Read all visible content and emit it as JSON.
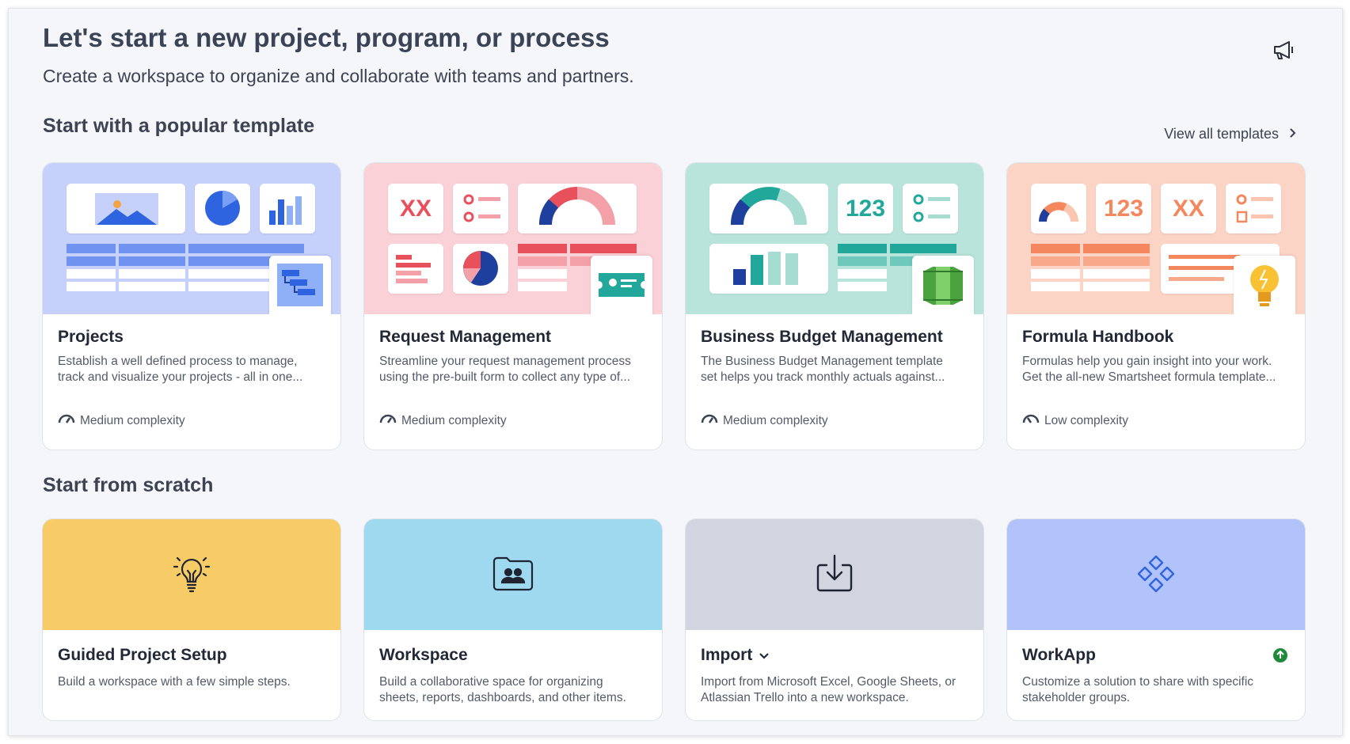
{
  "header": {
    "title": "Let's start a new project, program, or process",
    "subtitle": "Create a workspace to organize and collaborate with teams and partners.",
    "announce_icon": "megaphone-icon"
  },
  "templates_section": {
    "title": "Start with a popular template",
    "view_all": "View all templates",
    "cards": [
      {
        "title": "Projects",
        "desc1": "Establish a well defined process to manage,",
        "desc2": "track and visualize your projects - all in one...",
        "complexity": "Medium complexity",
        "bg": "#c5d1fb"
      },
      {
        "title": "Request Management",
        "desc1": "Streamline your request management process",
        "desc2": "using the pre-built form to collect any type of...",
        "complexity": "Medium complexity",
        "bg": "#f9d1d6",
        "tile_text": "XX"
      },
      {
        "title": "Business Budget Management",
        "desc1": "The Business Budget Management template",
        "desc2": "set helps you track monthly actuals against...",
        "complexity": "Medium complexity",
        "bg": "#b9e4dc",
        "tile_text": "123"
      },
      {
        "title": "Formula Handbook",
        "desc1": "Formulas help you gain insight into your work.",
        "desc2": "Get the all-new Smartsheet formula template...",
        "complexity": "Low complexity",
        "bg": "#fbd4c6",
        "tile_text_1": "123",
        "tile_text_2": "XX"
      }
    ]
  },
  "scratch_section": {
    "title": "Start from scratch",
    "cards": [
      {
        "title": "Guided Project Setup",
        "desc1": "Build a workspace with a few simple steps.",
        "desc2": "",
        "icon": "lightbulb-icon",
        "bg": "#f7cb65"
      },
      {
        "title": "Workspace",
        "desc1": "Build a collaborative space for organizing",
        "desc2": "sheets, reports, dashboards, and other items.",
        "icon": "workspace-folder-icon",
        "bg": "#9fd9f0"
      },
      {
        "title": "Import",
        "desc1": "Import from Microsoft Excel, Google Sheets, or",
        "desc2": "Atlassian Trello into a new workspace.",
        "icon": "import-icon",
        "bg": "#d2d4e0"
      },
      {
        "title": "WorkApp",
        "desc1": "Customize a solution to share with specific",
        "desc2": "stakeholder groups.",
        "icon": "workapp-icon",
        "bg": "#b2c2fb"
      }
    ]
  },
  "colors": {
    "blue": "#2f64e0",
    "navy": "#1f3f9e",
    "red": "#e8505b",
    "teal": "#22a89a",
    "orange": "#f4875e",
    "upgrade_green": "#1e8a3a"
  }
}
